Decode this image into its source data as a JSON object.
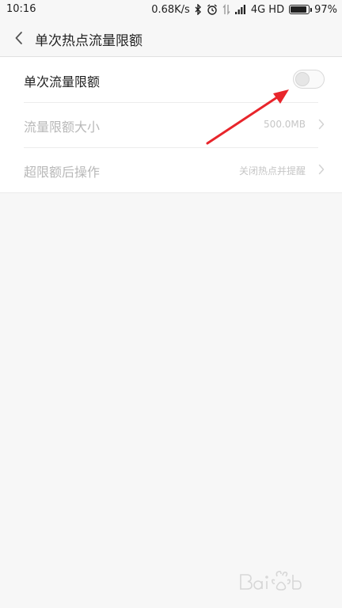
{
  "status_bar": {
    "time": "10:16",
    "net_speed": "0.68K/s",
    "network": "4G HD",
    "battery": "97%",
    "battery_level": 0.97
  },
  "header": {
    "title": "单次热点流量限额"
  },
  "settings": [
    {
      "label": "单次流量限额",
      "enabled": true,
      "toggle_on": false
    },
    {
      "label": "流量限额大小",
      "value": "500.0MB",
      "enabled": false
    },
    {
      "label": "超限额后操作",
      "value": "关闭热点并提醒",
      "enabled": false
    }
  ],
  "colors": {
    "background": "#f7f7f7",
    "annotation_arrow": "#e8252b"
  },
  "icons": {
    "back": "back-arrow-icon",
    "chevron": "chevron-right-icon"
  }
}
